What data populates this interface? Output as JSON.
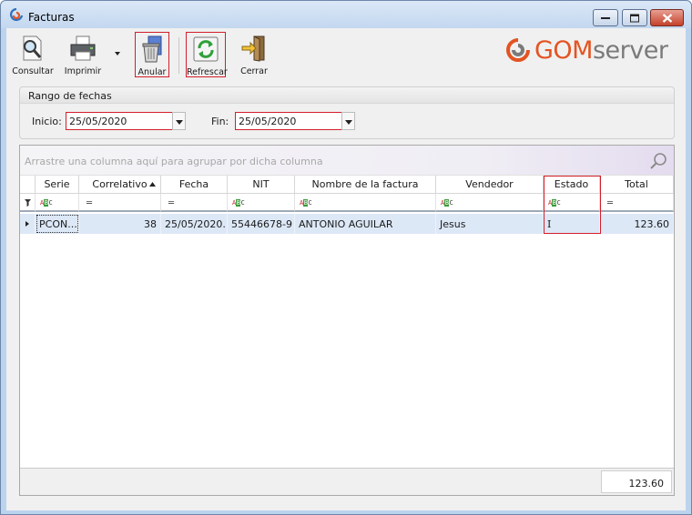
{
  "window": {
    "title": "Facturas"
  },
  "toolbar": {
    "consultar": "Consultar",
    "imprimir": "Imprimir",
    "anular": "Anular",
    "refrescar": "Refrescar",
    "cerrar": "Cerrar"
  },
  "brand": {
    "part1": "GOM",
    "part2": "server",
    "accent": "#e35422"
  },
  "date_range": {
    "title": "Rango de fechas",
    "start_label": "Inicio:",
    "start_value": "25/05/2020",
    "end_label": "Fin:",
    "end_value": "25/05/2020"
  },
  "grid": {
    "group_hint": "Arrastre una columna aquí para agrupar por dicha columna",
    "columns": [
      "Serie",
      "Correlativo",
      "Fecha",
      "NIT",
      "Nombre de la factura",
      "Vendedor",
      "Estado",
      "Total"
    ],
    "sort": {
      "column": "Correlativo",
      "direction": "ascending"
    },
    "rows": [
      {
        "serie": "PCON...",
        "correlativo": "38",
        "fecha": "25/05/2020...",
        "nit": "55446678-9",
        "nombre": "ANTONIO AGUILAR",
        "vendedor": "Jesus",
        "estado": "I",
        "total": "123.60"
      }
    ],
    "footer_total": "123.60"
  },
  "icons": [
    "app-icon",
    "minimize-icon",
    "maximize-icon",
    "close-icon",
    "search-doc-icon",
    "printer-icon",
    "trash-icon",
    "refresh-icon",
    "exit-door-icon",
    "gom-logo-icon",
    "search-icon",
    "filter-icon",
    "abc-filter-icon",
    "equals-filter-icon",
    "sort-asc-icon",
    "row-indicator-icon"
  ]
}
